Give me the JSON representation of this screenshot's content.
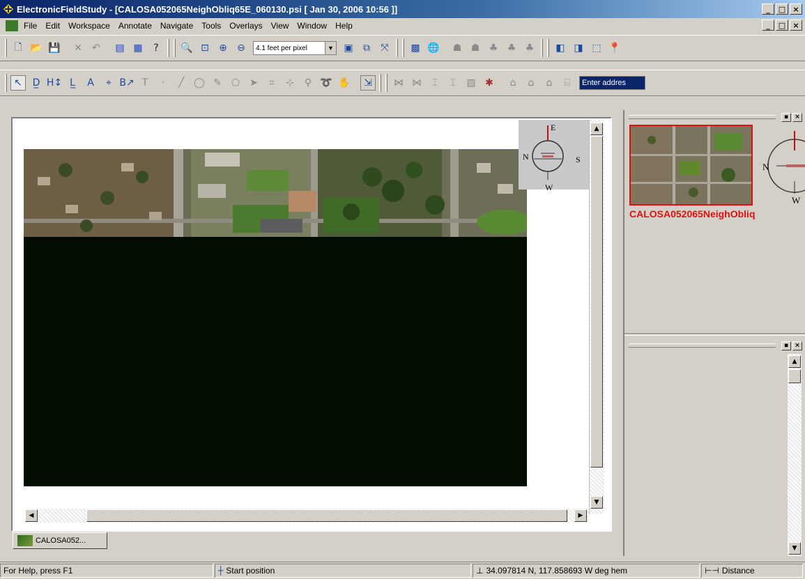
{
  "window": {
    "title": "ElectronicFieldStudy - [CALOSA052065NeighObliq65E_060130.psi [ Jan 30, 2006 10:56 ]]",
    "min_label": "_",
    "max_label": "□",
    "close_label": "×"
  },
  "menu": {
    "items": [
      "File",
      "Edit",
      "Workspace",
      "Annotate",
      "Navigate",
      "Tools",
      "Overlays",
      "View",
      "Window",
      "Help"
    ]
  },
  "toolbar1": {
    "zoom_value": "4.1 feet per pixel"
  },
  "toolbar2": {
    "address_placeholder": "Enter addres"
  },
  "compass": {
    "n": "N",
    "e": "E",
    "s": "S",
    "w": "W"
  },
  "overview": {
    "label": "CALOSA052065NeighObliq",
    "compass_n": "N",
    "compass_w": "W"
  },
  "doc_tab": {
    "label": "CALOSA052..."
  },
  "status": {
    "help": "For Help, press F1",
    "start": "Start position",
    "coords": "34.097814 N, 117.858693 W deg hem",
    "distance": "Distance"
  },
  "colors": {
    "title_bar": "#0a246a",
    "overview_highlight": "#e01010",
    "image_background": "#020d02"
  }
}
